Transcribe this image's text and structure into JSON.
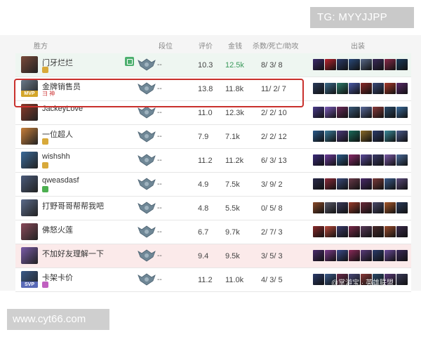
{
  "watermarks": {
    "tg": "TG: MYYJJPP",
    "site": "www.cyt66.com",
    "corner": "@掌游宝 · 英雄联盟"
  },
  "headers": {
    "side": "胜方",
    "rank": "段位",
    "score": "评价",
    "gold": "金钱",
    "kda": "杀数/死亡/助攻",
    "items": "出装"
  },
  "colors": {
    "win_bg": "#eef6f1",
    "loss_bg": "#fbeaea",
    "highlight": "#c9302c",
    "gold_green": "#3a9a5b",
    "mvp": "#d4a62a"
  },
  "rows": [
    {
      "name": "门牙烂烂",
      "tag": "",
      "mvp": "",
      "share": true,
      "rank": "--",
      "score": "10.3",
      "gold": "12.5k",
      "gold_green": true,
      "kda": "8/ 3/ 8",
      "bg": "win",
      "avatar": "#7a4a3a",
      "badge": "#d8a93a",
      "items": [
        "#3a2a6a",
        "#b8232f",
        "#2c3c6a",
        "#2a4a7a",
        "#5a6a8a",
        "#3a2a5a",
        "#8a2a4a",
        "#1a3a5a"
      ]
    },
    {
      "name": "金牌销售员",
      "tag": "彐 神",
      "mvp": "MVP",
      "share": false,
      "rank": "--",
      "score": "13.8",
      "gold": "11.8k",
      "gold_green": false,
      "kda": "11/ 2/ 7",
      "bg": "highlight",
      "avatar": "#6a7a8a",
      "badge": "",
      "items": [
        "#2a3a5a",
        "#3a6a8a",
        "#2c7a6a",
        "#4a5aa8",
        "#8a2a2a",
        "#3a4a7a",
        "#a8382a",
        "#5a2a6a"
      ]
    },
    {
      "name": "JackeyLove",
      "tag": "",
      "mvp": "",
      "share": false,
      "rank": "--",
      "score": "11.0",
      "gold": "12.3k",
      "gold_green": false,
      "kda": "2/ 2/ 10",
      "bg": "plain",
      "avatar": "#8a3a2a",
      "badge": "",
      "items": [
        "#4a3a8a",
        "#7a5ab8",
        "#6a2a5a",
        "#3a5a7a",
        "#5a6a9a",
        "#8a3a3a",
        "#2a4a6a",
        "#3a6a9a"
      ]
    },
    {
      "name": "一位超人",
      "tag": "",
      "mvp": "",
      "share": false,
      "rank": "--",
      "score": "7.9",
      "gold": "7.1k",
      "gold_green": false,
      "kda": "2/ 2/ 12",
      "bg": "plain",
      "avatar": "#c8803a",
      "badge": "#d8a93a",
      "items": [
        "#2a5a8a",
        "#3a7a9a",
        "#4a3a7a",
        "#1a6a5a",
        "#8a6a2a",
        "#2a3a6a",
        "#3a8a9a",
        "#4a5a8a"
      ]
    },
    {
      "name": "wishshh",
      "tag": "",
      "mvp": "",
      "share": false,
      "rank": "--",
      "score": "11.2",
      "gold": "11.2k",
      "gold_green": false,
      "kda": "6/ 3/ 13",
      "bg": "plain",
      "avatar": "#3a6a9a",
      "badge": "#d8a93a",
      "items": [
        "#3a2a7a",
        "#6a3a9a",
        "#2a5a8a",
        "#8a2a6a",
        "#5a4a9a",
        "#3a3a6a",
        "#7a5aa8",
        "#4a6a9a"
      ]
    },
    {
      "name": "qweasdasf",
      "tag": "",
      "mvp": "",
      "share": false,
      "rank": "--",
      "score": "4.9",
      "gold": "7.5k",
      "gold_green": false,
      "kda": "3/ 9/ 2",
      "bg": "plain",
      "avatar": "#4a5a7a",
      "badge": "#4caf50",
      "items": [
        "#2a2a4a",
        "#8a2a3a",
        "#3a4a7a",
        "#6a3a4a",
        "#4a2a6a",
        "#7a3a3a",
        "#3a5a8a",
        "#5a4a7a"
      ]
    },
    {
      "name": "打野哥哥帮帮我吧",
      "tag": "",
      "mvp": "",
      "share": false,
      "rank": "--",
      "score": "4.8",
      "gold": "5.5k",
      "gold_green": false,
      "kda": "0/ 5/ 8",
      "bg": "plain",
      "avatar": "#5a6a8a",
      "badge": "",
      "items": [
        "#8a4a2a",
        "#5a5a6a",
        "#3a3a5a",
        "#9a3a2a",
        "#6a2a3a",
        "#4a4a6a",
        "#a8582a",
        "#2a3a5a"
      ]
    },
    {
      "name": "佛怒火莲",
      "tag": "",
      "mvp": "",
      "share": false,
      "rank": "--",
      "score": "6.7",
      "gold": "9.7k",
      "gold_green": false,
      "kda": "2/ 7/ 3",
      "bg": "plain",
      "avatar": "#8a4a5a",
      "badge": "",
      "items": [
        "#8a2a2a",
        "#b8483a",
        "#3a3a6a",
        "#7a2a4a",
        "#5a3a5a",
        "#4a2a2a",
        "#9a4a2a",
        "#3a2a4a"
      ]
    },
    {
      "name": "不加好友理解一下",
      "tag": "",
      "mvp": "",
      "share": false,
      "rank": "--",
      "score": "9.4",
      "gold": "9.5k",
      "gold_green": false,
      "kda": "3/ 5/ 3",
      "bg": "loss",
      "avatar": "#7a5aa8",
      "badge": "",
      "items": [
        "#4a2a6a",
        "#7a3a8a",
        "#3a4a8a",
        "#8a2a5a",
        "#5a3a7a",
        "#2a3a6a",
        "#6a4a9a",
        "#3a2a5a"
      ]
    },
    {
      "name": "卡架卡价",
      "tag": "",
      "mvp": "SVP",
      "share": false,
      "rank": "--",
      "score": "11.2",
      "gold": "11.0k",
      "gold_green": false,
      "kda": "4/ 3/ 5",
      "bg": "plain",
      "avatar": "#3a5a8a",
      "badge": "#c060c0",
      "items": [
        "#2a3a6a",
        "#3a5a8a",
        "#6a2a4a",
        "#4a4a7a",
        "#8a3a3a",
        "#2a4a6a",
        "#5a3a7a",
        "#3a3a5a"
      ]
    }
  ]
}
